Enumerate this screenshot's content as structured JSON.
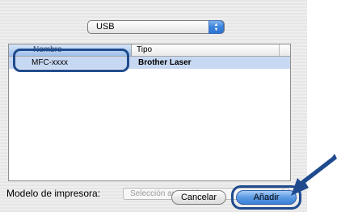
{
  "connection_popup": {
    "selected": "USB"
  },
  "printer_list": {
    "columns": {
      "name": "Nombre",
      "type": "Tipo"
    },
    "rows": [
      {
        "name": "MFC-xxxx",
        "type": "Brother Laser"
      }
    ]
  },
  "model": {
    "label": "Modelo de impresora:",
    "selected": "Selección automática"
  },
  "buttons": {
    "cancel": "Cancelar",
    "add": "Añadir"
  },
  "colors": {
    "annotation": "#1f4b8e",
    "selection": "#c7d8f2",
    "accent": "#3c83de"
  },
  "icons": {
    "popup_arrows": "updown-arrows-icon",
    "callout": "pointer-arrow-icon"
  }
}
